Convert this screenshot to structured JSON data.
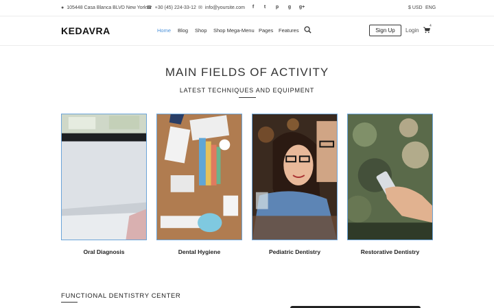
{
  "topbar": {
    "address": "105448 Casa Blanca BLVD New York",
    "phone": "+30 (45) 224-33-12",
    "email": "info@yoursite.com",
    "currency": "$ USD",
    "language": "ENG",
    "social": [
      {
        "name": "facebook-icon",
        "glyph": "f"
      },
      {
        "name": "twitter-icon",
        "glyph": "t"
      },
      {
        "name": "pinterest-icon",
        "glyph": "p"
      },
      {
        "name": "github-icon",
        "glyph": "g"
      },
      {
        "name": "google-plus-icon",
        "glyph": "g+"
      }
    ]
  },
  "navbar": {
    "logo": "KEDAVRA",
    "links": {
      "home": "Home",
      "blog": "Blog",
      "shop": "Shop",
      "mega": "Shop Mega-Menu",
      "pages": "Pages",
      "features": "Features"
    },
    "signup": "Sign Up",
    "login": "Login",
    "cart_count": "4",
    "accent_color": "#4a90d9"
  },
  "section": {
    "title": "MAIN FIELDS OF ACTIVITY",
    "subtitle": "LATEST TECHNIQUES AND EQUIPMENT"
  },
  "cards": {
    "c1": "Oral Diagnosis",
    "c2": "Dental Hygiene",
    "c3": "Pediatric Dentistry",
    "c4": "Restorative Dentistry"
  },
  "bottom": {
    "title": "FUNCTIONAL DENTISTRY CENTER"
  }
}
